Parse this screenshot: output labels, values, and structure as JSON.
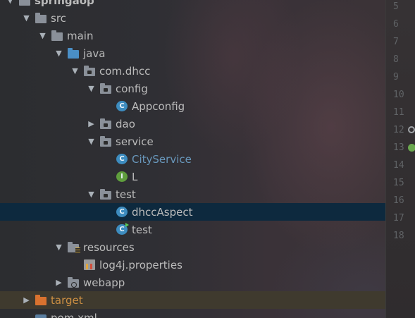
{
  "project_tree": {
    "items": [
      {
        "label": "springaop",
        "depth": 0,
        "kind": "module",
        "expanded": true
      },
      {
        "label": "src",
        "depth": 1,
        "kind": "folder",
        "expanded": true
      },
      {
        "label": "main",
        "depth": 2,
        "kind": "folder",
        "expanded": true
      },
      {
        "label": "java",
        "depth": 3,
        "kind": "source-folder",
        "expanded": true
      },
      {
        "label": "com.dhcc",
        "depth": 4,
        "kind": "package",
        "expanded": true
      },
      {
        "label": "config",
        "depth": 5,
        "kind": "package",
        "expanded": true
      },
      {
        "label": "Appconfig",
        "depth": 6,
        "kind": "class"
      },
      {
        "label": "dao",
        "depth": 5,
        "kind": "package",
        "expanded": false
      },
      {
        "label": "service",
        "depth": 5,
        "kind": "package",
        "expanded": true
      },
      {
        "label": "CityService",
        "depth": 6,
        "kind": "class",
        "modified": true
      },
      {
        "label": "L",
        "depth": 6,
        "kind": "interface"
      },
      {
        "label": "test",
        "depth": 5,
        "kind": "package",
        "expanded": true
      },
      {
        "label": "dhccAspect",
        "depth": 6,
        "kind": "class",
        "selected": true
      },
      {
        "label": "test",
        "depth": 6,
        "kind": "runnable-class"
      },
      {
        "label": "resources",
        "depth": 3,
        "kind": "resources-folder",
        "expanded": true
      },
      {
        "label": "log4j.properties",
        "depth": 4,
        "kind": "properties-file"
      },
      {
        "label": "webapp",
        "depth": 3,
        "kind": "web-folder",
        "expanded": false
      },
      {
        "label": "target",
        "depth": 1,
        "kind": "excluded-folder",
        "expanded": false
      },
      {
        "label": "pom.xml",
        "depth": 1,
        "kind": "xml-file"
      }
    ]
  },
  "editor_gutter": {
    "line_numbers": [
      "5",
      "6",
      "7",
      "8",
      "9",
      "10",
      "11",
      "12",
      "13",
      "14",
      "15",
      "16",
      "17",
      "18"
    ],
    "markers": [
      {
        "line": "12",
        "icon": "search-icon"
      },
      {
        "line": "13",
        "icon": "spring-leaf-icon"
      }
    ]
  },
  "colors": {
    "selected_row": "#0d293e",
    "excluded_row": "#3f3a2e",
    "modified_text": "#6897bb",
    "excluded_text": "#cc8f43",
    "class_icon": "#3d8cbf",
    "interface_icon": "#5f9e3d"
  }
}
